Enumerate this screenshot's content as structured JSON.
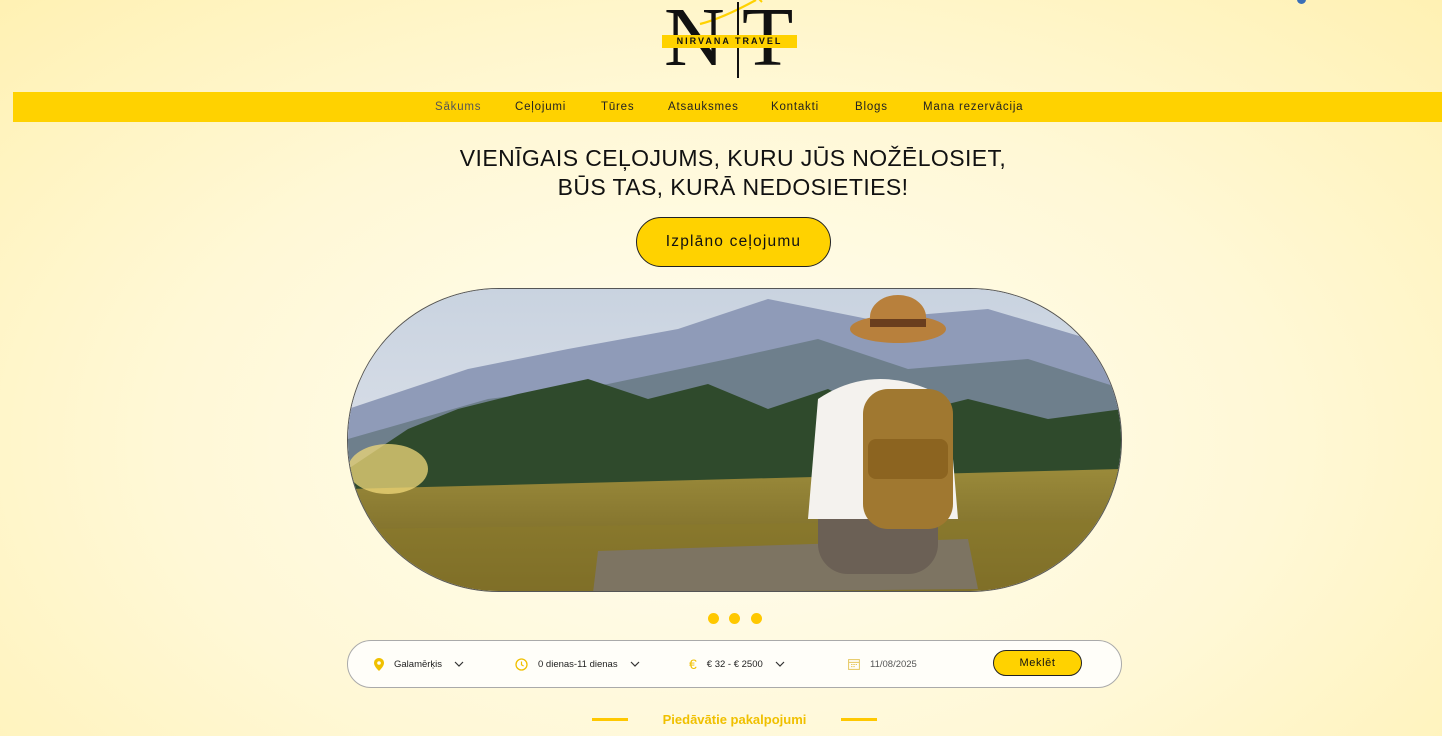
{
  "brand": {
    "name": "NIRVANA TRAVEL",
    "monogram_left": "N",
    "monogram_right": "T"
  },
  "colors": {
    "accent": "#ffd200",
    "background": "#fff8d6",
    "text": "#111111",
    "section_title": "#f0c000"
  },
  "nav": {
    "items": [
      {
        "label": "Sākums",
        "active": true
      },
      {
        "label": "Ceļojumi",
        "active": false
      },
      {
        "label": "Tūres",
        "active": false
      },
      {
        "label": "Atsauksmes",
        "active": false
      },
      {
        "label": "Kontakti",
        "active": false
      },
      {
        "label": "Blogs",
        "active": false
      },
      {
        "label": "Mana rezervācija",
        "active": false
      }
    ]
  },
  "hero": {
    "headline_line1": "VIENĪGAIS CEĻOJUMS, KURU JŪS NOŽĒLOSIET,",
    "headline_line2": "BŪS TAS, KURĀ NEDOSIETIES!",
    "cta_label": "Izplāno ceļojumu"
  },
  "slider": {
    "count": 3
  },
  "search": {
    "destination": {
      "value": "Galamērķis",
      "icon": "map-pin-icon"
    },
    "duration": {
      "value": "0 dienas-11 dienas",
      "icon": "clock-icon"
    },
    "price": {
      "value": "€ 32 - € 2500",
      "icon": "euro-icon"
    },
    "date": {
      "value": "11/08/2025",
      "icon": "calendar-icon"
    },
    "button_label": "Meklēt"
  },
  "services": {
    "title": "Piedāvātie pakalpojumi"
  }
}
